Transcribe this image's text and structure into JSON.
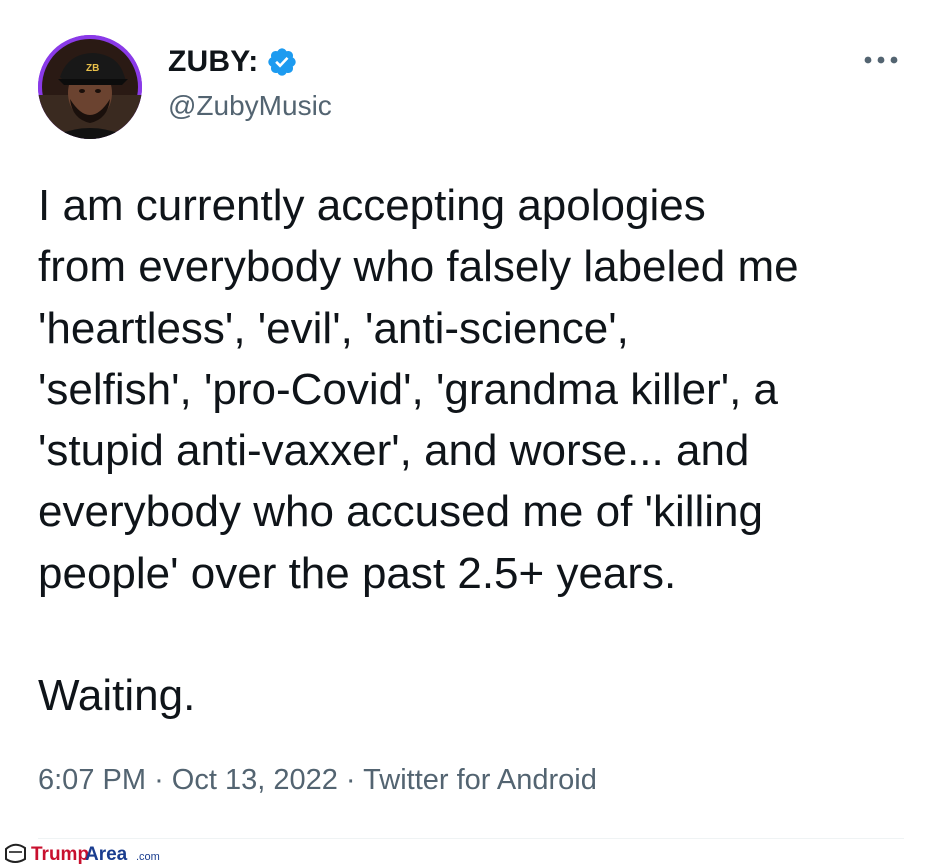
{
  "author": {
    "display_name": "ZUBY:",
    "handle": "@ZubyMusic",
    "verified": true,
    "avatar_icon": "avatar-photo",
    "avatar_bg_color": "#7c2ad8"
  },
  "tweet": {
    "lines": [
      "I am currently accepting apologies",
      "from everybody who falsely labeled me",
      "'heartless', 'evil', 'anti-science',",
      "'selfish', 'pro-Covid', 'grandma killer', a",
      "'stupid anti-vaxxer', and worse... and",
      "everybody who accused me of 'killing",
      "people' over the past 2.5+ years.",
      "",
      "Waiting."
    ]
  },
  "meta": {
    "time": "6:07 PM",
    "separator": "·",
    "date": "Oct 13, 2022",
    "source": "Twitter for Android"
  },
  "icons": {
    "verified": "verified-badge-icon",
    "more": "more-horizontal-icon"
  },
  "colors": {
    "text": "#0f1419",
    "secondary": "#536471",
    "verified_blue": "#1d9bf0",
    "watermark_red": "#c8102e",
    "watermark_blue": "#1a3d8f"
  },
  "watermark": {
    "logo": "TrumpArea logo",
    "part1": "Trump",
    "part2": "Area",
    "suffix": ".com"
  }
}
